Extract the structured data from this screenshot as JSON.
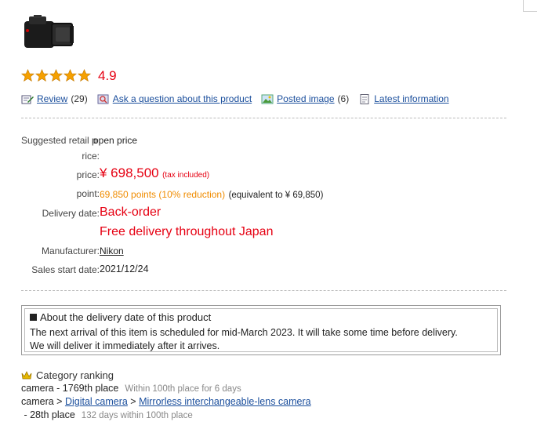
{
  "product": {
    "rating": "4.9",
    "star_color": "#f5a000"
  },
  "toolbar": {
    "review_label": "Review",
    "review_count": "(29)",
    "question_label": "Ask a question about this product",
    "posted_image_label": "Posted image",
    "posted_image_count": "(6)",
    "latest_info_label": "Latest information"
  },
  "pricing": {
    "suggested_retail_label": "Suggested retail p",
    "open_price_label": "open price",
    "rice_label": "rice:",
    "price_label": "price:",
    "price_value": "¥ 698,500",
    "tax_note": "(tax included)",
    "point_label": "point:",
    "points_value": "69,850 points (10% reduction)",
    "points_equiv": "(equivalent to ¥ 69,850)",
    "delivery_label": "Delivery date:",
    "delivery_value": "Back-order",
    "free_delivery": "Free delivery throughout Japan",
    "manufacturer_label": "Manufacturer:",
    "manufacturer_value": "Nikon",
    "sales_start_label": "Sales start date:",
    "sales_start_value": "2021/12/24"
  },
  "notice": {
    "title": "About the delivery date of this product",
    "line1": "The next arrival of this item is scheduled for mid-March 2023. It will take some time before delivery.",
    "line2": "We will deliver it immediately after it arrives."
  },
  "ranking": {
    "title": "Category ranking",
    "line1_text": "camera - 1769th place",
    "line1_note": "Within 100th place for 6 days",
    "line2_prefix": "camera > ",
    "line2_link1": "Digital camera",
    "line2_sep": " > ",
    "line2_link2": "Mirrorless interchangeable-lens camera",
    "line3_text": " - 28th place",
    "line3_note": "132 days within 100th place"
  }
}
